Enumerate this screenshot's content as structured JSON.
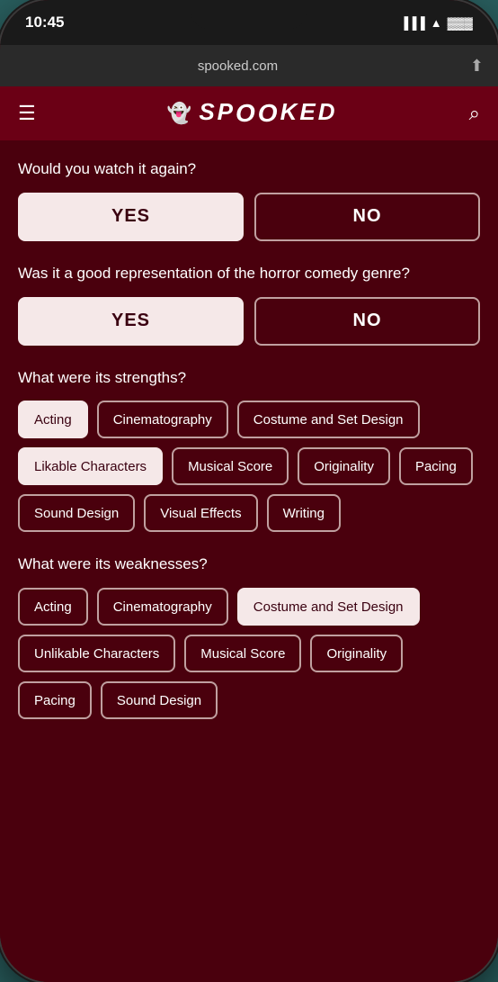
{
  "statusBar": {
    "time": "10:45",
    "url": "spooked.com"
  },
  "header": {
    "logoText": "SP👻KED",
    "menuIcon": "☰",
    "searchIcon": "🔍"
  },
  "sections": [
    {
      "id": "watch-again",
      "label": "Would you watch it again?",
      "type": "yn",
      "yesLabel": "YES",
      "noLabel": "NO",
      "selectedYes": true
    },
    {
      "id": "horror-comedy",
      "label": "Was it a good representation of the horror comedy genre?",
      "type": "yn",
      "yesLabel": "YES",
      "noLabel": "NO",
      "selectedYes": true
    },
    {
      "id": "strengths",
      "label": "What were its strengths?",
      "type": "tags",
      "tags": [
        {
          "label": "Acting",
          "selected": true
        },
        {
          "label": "Cinematography",
          "selected": false
        },
        {
          "label": "Costume and Set Design",
          "selected": false
        },
        {
          "label": "Likable Characters",
          "selected": true
        },
        {
          "label": "Musical Score",
          "selected": false
        },
        {
          "label": "Originality",
          "selected": false
        },
        {
          "label": "Pacing",
          "selected": false
        },
        {
          "label": "Sound Design",
          "selected": false
        },
        {
          "label": "Visual Effects",
          "selected": false
        },
        {
          "label": "Writing",
          "selected": false
        }
      ]
    },
    {
      "id": "weaknesses",
      "label": "What were its weaknesses?",
      "type": "tags",
      "tags": [
        {
          "label": "Acting",
          "selected": false
        },
        {
          "label": "Cinematography",
          "selected": false
        },
        {
          "label": "Costume and Set Design",
          "selected": true
        },
        {
          "label": "Unlikable Characters",
          "selected": false
        },
        {
          "label": "Musical Score",
          "selected": false
        },
        {
          "label": "Originality",
          "selected": false
        },
        {
          "label": "Pacing",
          "selected": false
        },
        {
          "label": "Sound Design",
          "selected": false
        }
      ]
    }
  ]
}
